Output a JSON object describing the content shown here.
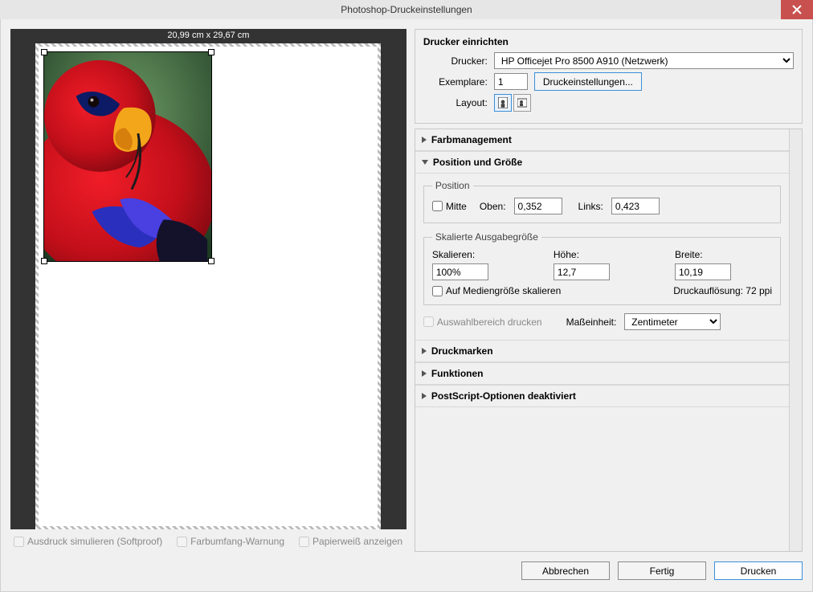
{
  "window": {
    "title": "Photoshop-Druckeinstellungen"
  },
  "preview": {
    "dimensions": "20,99 cm x 29,67 cm",
    "options": {
      "softproof": "Ausdruck simulieren (Softproof)",
      "gamut": "Farbumfang-Warnung",
      "paperwhite": "Papierweiß anzeigen"
    }
  },
  "printer_setup": {
    "heading": "Drucker einrichten",
    "printer_label": "Drucker:",
    "printer_selected": "HP Officejet Pro 8500 A910 (Netzwerk)",
    "copies_label": "Exemplare:",
    "copies_value": "1",
    "print_settings_btn": "Druckeinstellungen...",
    "layout_label": "Layout:"
  },
  "sections": {
    "color_mgmt": "Farbmanagement",
    "pos_size": {
      "title": "Position und Größe",
      "position_legend": "Position",
      "center_label": "Mitte",
      "top_label": "Oben:",
      "top_value": "0,352",
      "left_label": "Links:",
      "left_value": "0,423",
      "scaled_legend": "Skalierte Ausgabegröße",
      "scale_label": "Skalieren:",
      "scale_value": "100%",
      "height_label": "Höhe:",
      "height_value": "12,7",
      "width_label": "Breite:",
      "width_value": "10,19",
      "fit_media_label": "Auf Mediengröße skalieren",
      "resolution_label": "Druckauflösung: 72 ppi",
      "print_selection_label": "Auswahlbereich drucken",
      "unit_label": "Maßeinheit:",
      "unit_value": "Zentimeter"
    },
    "print_marks": "Druckmarken",
    "functions": "Funktionen",
    "postscript": "PostScript-Optionen deaktiviert"
  },
  "footer": {
    "cancel": "Abbrechen",
    "done": "Fertig",
    "print": "Drucken"
  }
}
